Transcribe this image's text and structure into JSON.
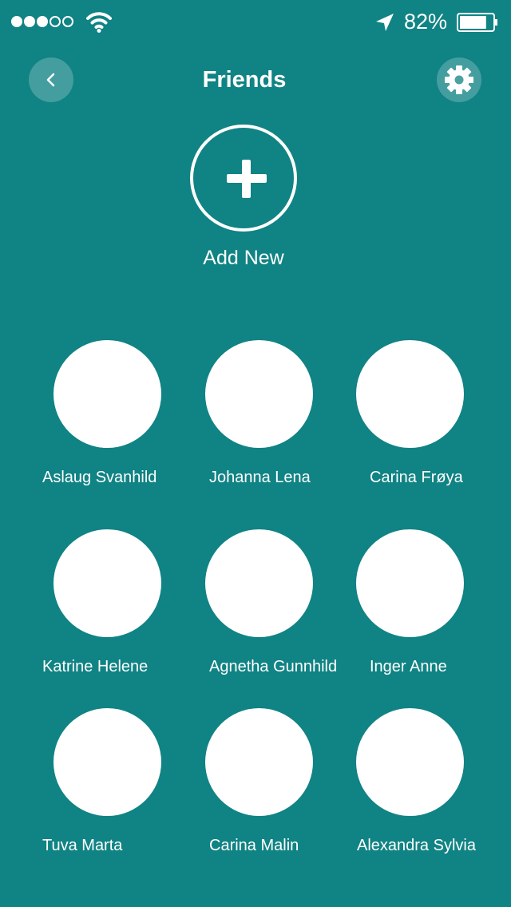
{
  "status_bar": {
    "signal_dots": [
      true,
      true,
      true,
      false,
      false
    ],
    "battery_percent": "82%",
    "battery_level": 0.82
  },
  "header": {
    "title": "Friends",
    "back_icon": "chevron-left-icon",
    "settings_icon": "gear-icon"
  },
  "add_new": {
    "label": "Add New",
    "icon": "plus-icon"
  },
  "friends": [
    {
      "name": "Aslaug Svanhild"
    },
    {
      "name": "Johanna Lena"
    },
    {
      "name": "Carina Frøya"
    },
    {
      "name": "Katrine Helene"
    },
    {
      "name": "Agnetha Gunnhild"
    },
    {
      "name": "Inger Anne"
    },
    {
      "name": "Tuva Marta"
    },
    {
      "name": "Carina Malin"
    },
    {
      "name": "Alexandra Sylvia"
    }
  ],
  "colors": {
    "background": "#108384",
    "foreground": "#ffffff"
  }
}
